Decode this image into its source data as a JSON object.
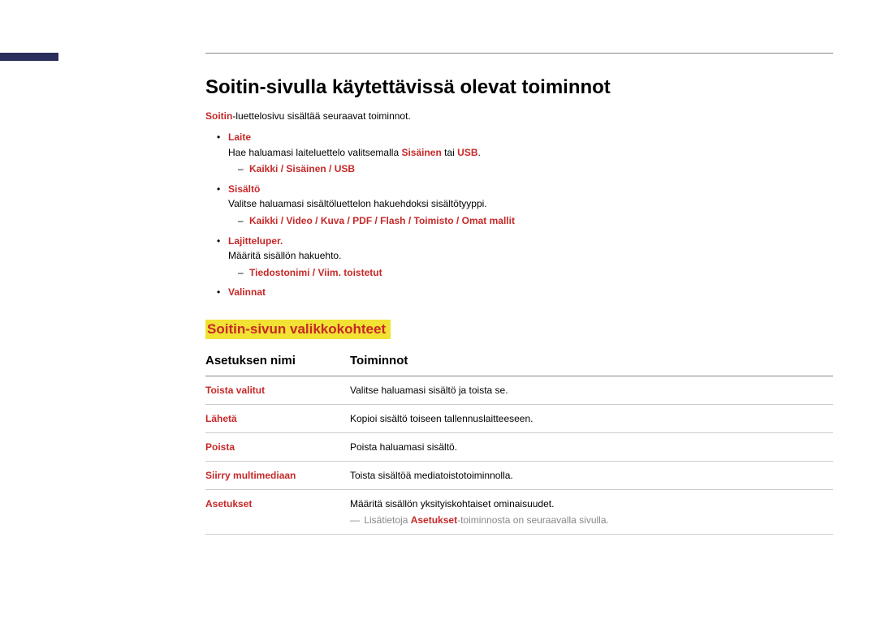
{
  "title": "Soitin-sivulla käytettävissä olevat toiminnot",
  "intro": {
    "prefix": "Soitin",
    "rest": "-luettelosivu sisältää seuraavat toiminnot."
  },
  "bullets": [
    {
      "label": "Laite",
      "desc_parts": [
        "Hae haluamasi laiteluettelo valitsemalla ",
        "Sisäinen",
        " tai ",
        "USB",
        "."
      ],
      "sub": "Kaikki / Sisäinen / USB"
    },
    {
      "label": "Sisältö",
      "desc_parts": [
        "Valitse haluamasi sisältöluettelon hakuehdoksi sisältötyyppi."
      ],
      "sub": "Kaikki / Video / Kuva / PDF / Flash / Toimisto / Omat mallit"
    },
    {
      "label": "Lajitteluper.",
      "desc_parts": [
        "Määritä sisällön hakuehto."
      ],
      "sub": "Tiedostonimi / Viim. toistetut"
    },
    {
      "label": "Valinnat"
    }
  ],
  "subhead": "Soitin-sivun valikkokohteet",
  "table": {
    "head_name": "Asetuksen nimi",
    "head_func": "Toiminnot",
    "rows": [
      {
        "name": "Toista valitut",
        "func": "Valitse haluamasi sisältö ja toista se."
      },
      {
        "name": "Lähetä",
        "func": "Kopioi sisältö toiseen tallennuslaitteeseen."
      },
      {
        "name": "Poista",
        "func": "Poista haluamasi sisältö."
      },
      {
        "name": "Siirry multimediaan",
        "func": "Toista sisältöä mediatoistotoiminnolla."
      },
      {
        "name": "Asetukset",
        "func": "Määritä sisällön yksityiskohtaiset ominaisuudet.",
        "note_pre": "Lisätietoja ",
        "note_bold": "Asetukset",
        "note_post": "-toiminnosta on seuraavalla sivulla."
      }
    ]
  }
}
